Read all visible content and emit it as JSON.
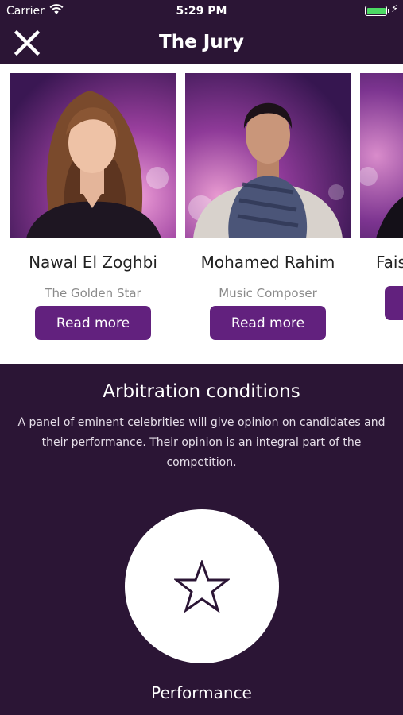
{
  "status_bar": {
    "carrier": "Carrier",
    "time": "5:29 PM"
  },
  "nav": {
    "title": "The Jury"
  },
  "jury": [
    {
      "name": "Nawal El Zoghbi",
      "role": "The Golden Star",
      "button": "Read more"
    },
    {
      "name": "Mohamed Rahim",
      "role": "Music Composer",
      "button": "Read more"
    },
    {
      "name": "Fais",
      "role": "",
      "button": ""
    }
  ],
  "conditions": {
    "title": "Arbitration conditions",
    "text": "A panel of eminent celebrities will give opinion on candidates and their performance. Their opinion is an integral part of the competition."
  },
  "performance": {
    "label": "Performance",
    "icon": "star-icon"
  },
  "colors": {
    "background": "#2b1535",
    "accent": "#62217e",
    "battery": "#4cd964"
  }
}
